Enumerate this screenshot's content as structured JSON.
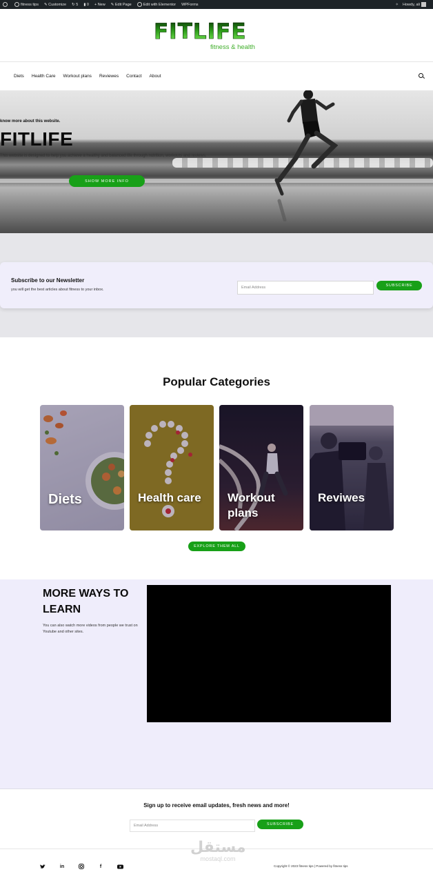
{
  "admin_bar": {
    "items": [
      "fitness tips",
      "Customize",
      "5",
      "0",
      "New",
      "Edit Page",
      "Edit with Elementor",
      "WPForms"
    ],
    "right": [
      "Howdy, ali"
    ]
  },
  "header": {
    "logo_word": "FITLIFE",
    "tagline": "fitness & health"
  },
  "nav": {
    "items": [
      "Diets",
      "Health Care",
      "Workout plans",
      "Reviewes",
      "Contact",
      "About"
    ]
  },
  "hero": {
    "kicker": "know more about this website.",
    "title": "FITLIFE",
    "text": "This website is designed to help you achieve a healthy and balanced life through nutrition, workouts and reviews.",
    "button": "SHOW MORE INFO"
  },
  "newsletter": {
    "title": "Subscribe to our Newsletter",
    "subtitle": "you will get the best articles about fitness to your inbox.",
    "placeholder": "Email Address",
    "button": "SUBSCRIBE"
  },
  "categories": {
    "title": "Popular Categories",
    "items": [
      {
        "label": "Diets"
      },
      {
        "label": "Health care"
      },
      {
        "label": "Workout plans"
      },
      {
        "label": "Reviwes"
      }
    ],
    "button": "EXPLORE THEM ALL"
  },
  "more_ways": {
    "title": "MORE WAYS TO LEARN",
    "text": "You can also watch more videos from people we trust on Youtube and other sites."
  },
  "signup": {
    "title": "Sign up to receive email updates, fresh news and more!",
    "placeholder": "Email Address",
    "button": "SUBSCRIBE"
  },
  "footer": {
    "social_icons": [
      "twitter-icon",
      "linkedin-icon",
      "instagram-icon",
      "facebook-icon",
      "youtube-icon"
    ],
    "copyright": "Copyright © 2023 fitness tips | Powered by fitness tips"
  },
  "watermark": {
    "arabic": "مستقل",
    "latin": "mostaql.com"
  },
  "colors": {
    "accent_green": "#18a018",
    "admin_bar": "#1d2327",
    "section_lavender": "#efedfb"
  }
}
